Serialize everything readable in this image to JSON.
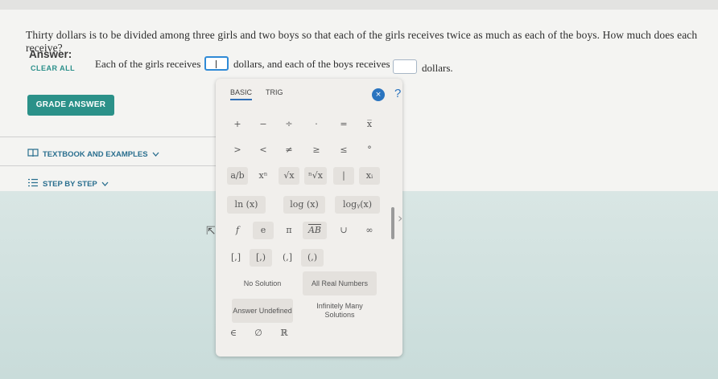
{
  "question": "Thirty dollars is to be divided among three girls and two boys so that each of the girls receives twice as much as each of the boys. How much does each receive?",
  "answer": {
    "label": "Answer:",
    "clear_all": "CLEAR ALL",
    "part1": "Each of the girls receives",
    "part2": "dollars, and each of the boys receives",
    "part3": "dollars."
  },
  "grade_button": "GRADE ANSWER",
  "textbook_link": "TEXTBOOK AND EXAMPLES",
  "step_link": "STEP BY STEP",
  "palette": {
    "tabs": [
      "BASIC",
      "TRIG"
    ],
    "row1": [
      "+",
      "−",
      "÷",
      "·",
      "=",
      "x̅"
    ],
    "row2": [
      ">",
      "<",
      "≠",
      "≥",
      "≤",
      "°"
    ],
    "row3": [
      "a/b",
      "xⁿ",
      "√x",
      "ⁿ√x",
      "|",
      "xᵢ"
    ],
    "row4": [
      "ln (x)",
      "log (x)",
      "logᵧ(x)"
    ],
    "row5": [
      "f",
      "e",
      "π",
      "AB",
      "∪",
      "∞"
    ],
    "row6": [
      "[,]",
      "[,)",
      "(,]",
      "(,)"
    ],
    "no_solution": "No Solution",
    "all_real": "All Real Numbers",
    "answer_undefined": "Answer Undefined",
    "infinitely_many": "Infinitely Many Solutions",
    "row9": [
      "∈",
      "∅",
      "ℝ"
    ],
    "close": "×",
    "help": "?"
  }
}
